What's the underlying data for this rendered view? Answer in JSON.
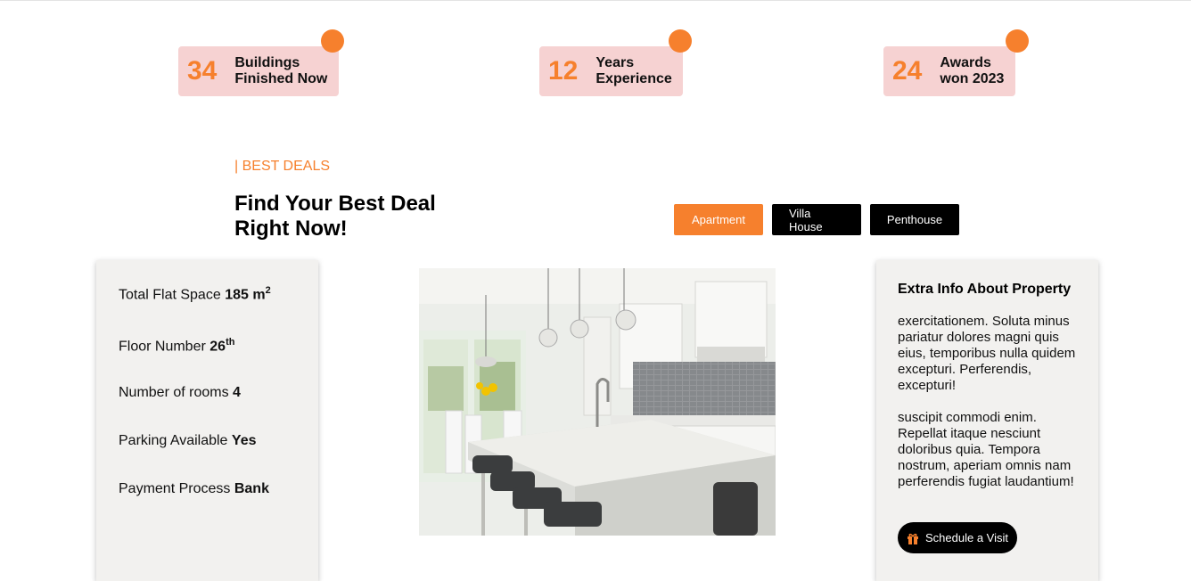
{
  "stats": [
    {
      "number": "34",
      "label": "Buildings\nFinished Now"
    },
    {
      "number": "12",
      "label": "Years\nExperience"
    },
    {
      "number": "24",
      "label": "Awards\nwon 2023"
    }
  ],
  "section": {
    "eyebrow": "| BEST DEALS",
    "headline": "Find Your Best Deal Right Now!"
  },
  "tabs": [
    "Apartment",
    "Villa House",
    "Penthouse"
  ],
  "specs": {
    "flat_space": {
      "label": "Total Flat Space",
      "value": "185 m",
      "sup": "2"
    },
    "floor": {
      "label": "Floor Number",
      "value": "26",
      "sup": "th"
    },
    "rooms": {
      "label": "Number of rooms",
      "value": "4"
    },
    "parking": {
      "label": "Parking Available",
      "value": "Yes"
    },
    "payment": {
      "label": "Payment Process",
      "value": "Bank"
    }
  },
  "info": {
    "title": "Extra Info About Property",
    "para1": "exercitationem. Soluta minus pariatur dolores magni quis eius, temporibus nulla quidem excepturi. Perferendis, excepturi!",
    "para2": "suscipit commodi enim. Repellat itaque nesciunt doloribus quia. Tempora nostrum, aperiam omnis nam perferendis fugiat laudantium!",
    "button": "Schedule a Visit"
  },
  "colors": {
    "accent": "#f6802d",
    "badge_bg": "#f6d2d2",
    "panel_bg": "#f2f1ef"
  }
}
